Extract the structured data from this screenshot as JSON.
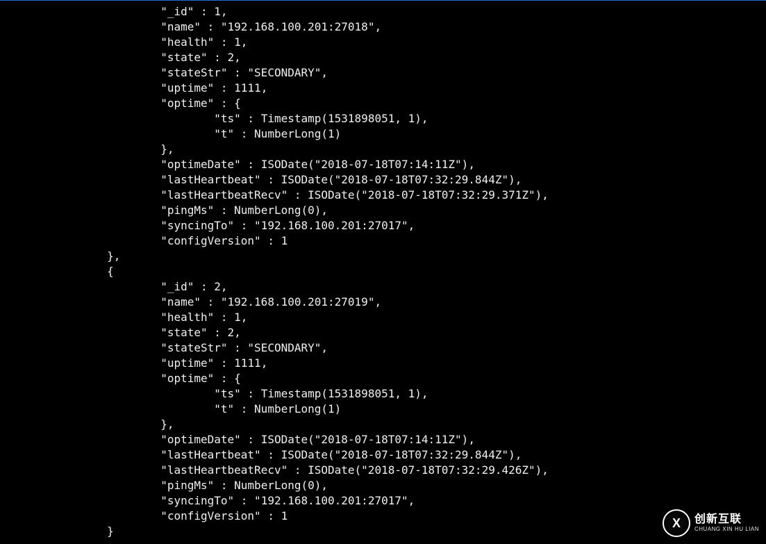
{
  "indent": {
    "l3": "                        ",
    "l4": "                                ",
    "l2_brace": "                },",
    "l2_open": "                {",
    "l2_close": "                }"
  },
  "members": [
    {
      "_id": 1,
      "name": "192.168.100.201:27018",
      "health": 1,
      "state": 2,
      "stateStr": "SECONDARY",
      "uptime": 1111,
      "optime_ts": "Timestamp(1531898051, 1)",
      "optime_t": "NumberLong(1)",
      "optimeDate": "ISODate(\"2018-07-18T07:14:11Z\")",
      "lastHeartbeat": "ISODate(\"2018-07-18T07:32:29.844Z\")",
      "lastHeartbeatRecv": "ISODate(\"2018-07-18T07:32:29.371Z\")",
      "pingMs": "NumberLong(0)",
      "syncingTo": "192.168.100.201:27017",
      "configVersion": 1
    },
    {
      "_id": 2,
      "name": "192.168.100.201:27019",
      "health": 1,
      "state": 2,
      "stateStr": "SECONDARY",
      "uptime": 1111,
      "optime_ts": "Timestamp(1531898051, 1)",
      "optime_t": "NumberLong(1)",
      "optimeDate": "ISODate(\"2018-07-18T07:14:11Z\")",
      "lastHeartbeat": "ISODate(\"2018-07-18T07:32:29.844Z\")",
      "lastHeartbeatRecv": "ISODate(\"2018-07-18T07:32:29.426Z\")",
      "pingMs": "NumberLong(0)",
      "syncingTo": "192.168.100.201:27017",
      "configVersion": 1
    }
  ],
  "watermark": {
    "cn": "创新互联",
    "en": "CHUANG XIN HU LIAN"
  }
}
